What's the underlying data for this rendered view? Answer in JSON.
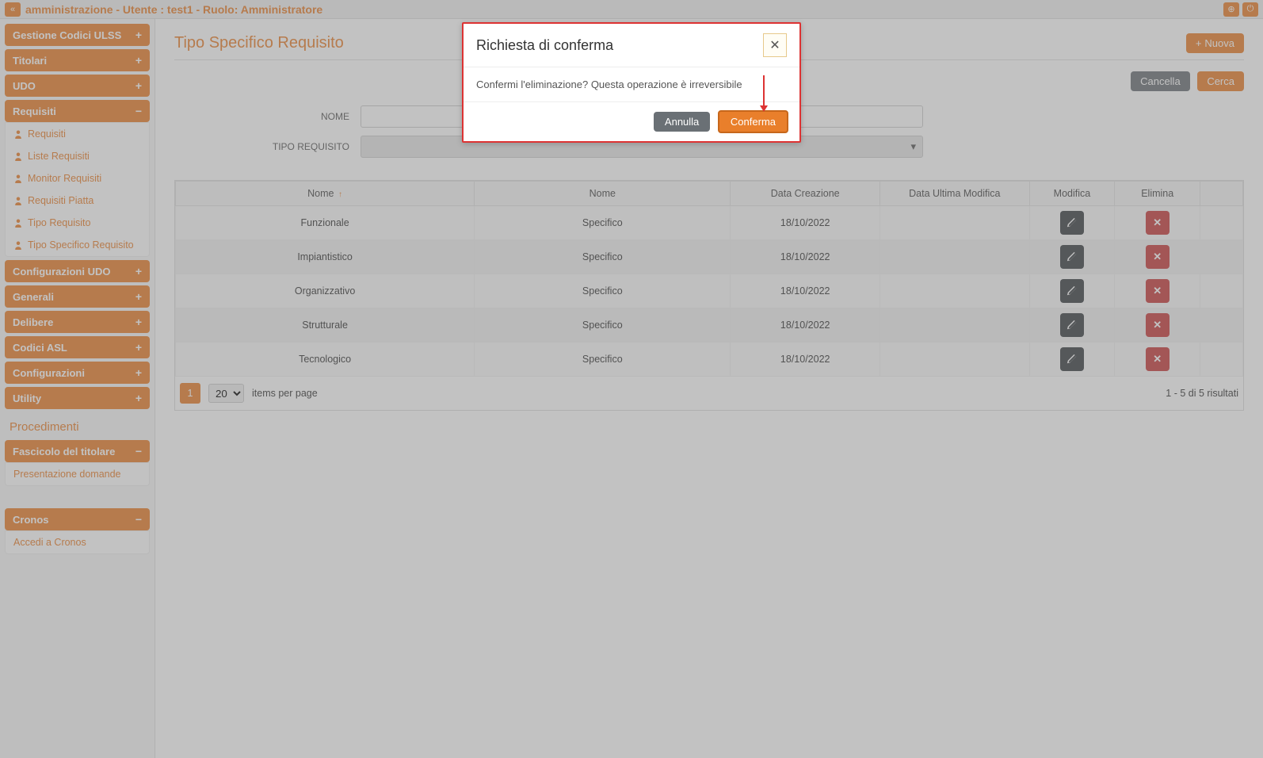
{
  "header": {
    "title": "amministrazione - Utente : test1 - Ruolo: Amministratore"
  },
  "sidebar": {
    "sections": [
      {
        "label": "Gestione Codici ULSS",
        "toggle": "+"
      },
      {
        "label": "Titolari",
        "toggle": "+"
      },
      {
        "label": "UDO",
        "toggle": "+"
      },
      {
        "label": "Requisiti",
        "toggle": "−",
        "items": [
          {
            "label": "Requisiti"
          },
          {
            "label": "Liste Requisiti"
          },
          {
            "label": "Monitor Requisiti"
          },
          {
            "label": "Requisiti Piatta"
          },
          {
            "label": "Tipo Requisito"
          },
          {
            "label": "Tipo Specifico Requisito"
          }
        ]
      },
      {
        "label": "Configurazioni UDO",
        "toggle": "+"
      },
      {
        "label": "Generali",
        "toggle": "+"
      },
      {
        "label": "Delibere",
        "toggle": "+"
      },
      {
        "label": "Codici ASL",
        "toggle": "+"
      },
      {
        "label": "Configurazioni",
        "toggle": "+"
      },
      {
        "label": "Utility",
        "toggle": "+"
      }
    ],
    "plain_title": "Procedimenti",
    "sections2": [
      {
        "label": "Fascicolo del titolare",
        "toggle": "−",
        "items": [
          {
            "label": "Presentazione domande"
          }
        ]
      }
    ],
    "sections3": [
      {
        "label": "Cronos",
        "toggle": "−",
        "items": [
          {
            "label": "Accedi a Cronos"
          }
        ]
      }
    ]
  },
  "main": {
    "page_title": "Tipo Specifico Requisito",
    "nuova": "Nuova",
    "filters": {
      "nome_label": "NOME",
      "tipo_label": "TIPO REQUISITO"
    },
    "search": {
      "cancel": "Cancella",
      "search": "Cerca"
    },
    "table": {
      "headers": [
        "Nome",
        "Nome",
        "Data Creazione",
        "Data Ultima Modifica",
        "Modifica",
        "Elimina"
      ],
      "rows": [
        {
          "nome": "Funzionale",
          "nome2": "Specifico",
          "data_cre": "18/10/2022",
          "data_mod": ""
        },
        {
          "nome": "Impiantistico",
          "nome2": "Specifico",
          "data_cre": "18/10/2022",
          "data_mod": ""
        },
        {
          "nome": "Organizzativo",
          "nome2": "Specifico",
          "data_cre": "18/10/2022",
          "data_mod": ""
        },
        {
          "nome": "Strutturale",
          "nome2": "Specifico",
          "data_cre": "18/10/2022",
          "data_mod": ""
        },
        {
          "nome": "Tecnologico",
          "nome2": "Specifico",
          "data_cre": "18/10/2022",
          "data_mod": ""
        }
      ]
    },
    "pager": {
      "page": "1",
      "page_size": "20",
      "items_label": "items per page",
      "summary": "1 - 5 di 5 risultati"
    }
  },
  "modal": {
    "title": "Richiesta di conferma",
    "body": "Confermi l'eliminazione? Questa operazione è irreversibile",
    "cancel": "Annulla",
    "confirm": "Conferma"
  }
}
